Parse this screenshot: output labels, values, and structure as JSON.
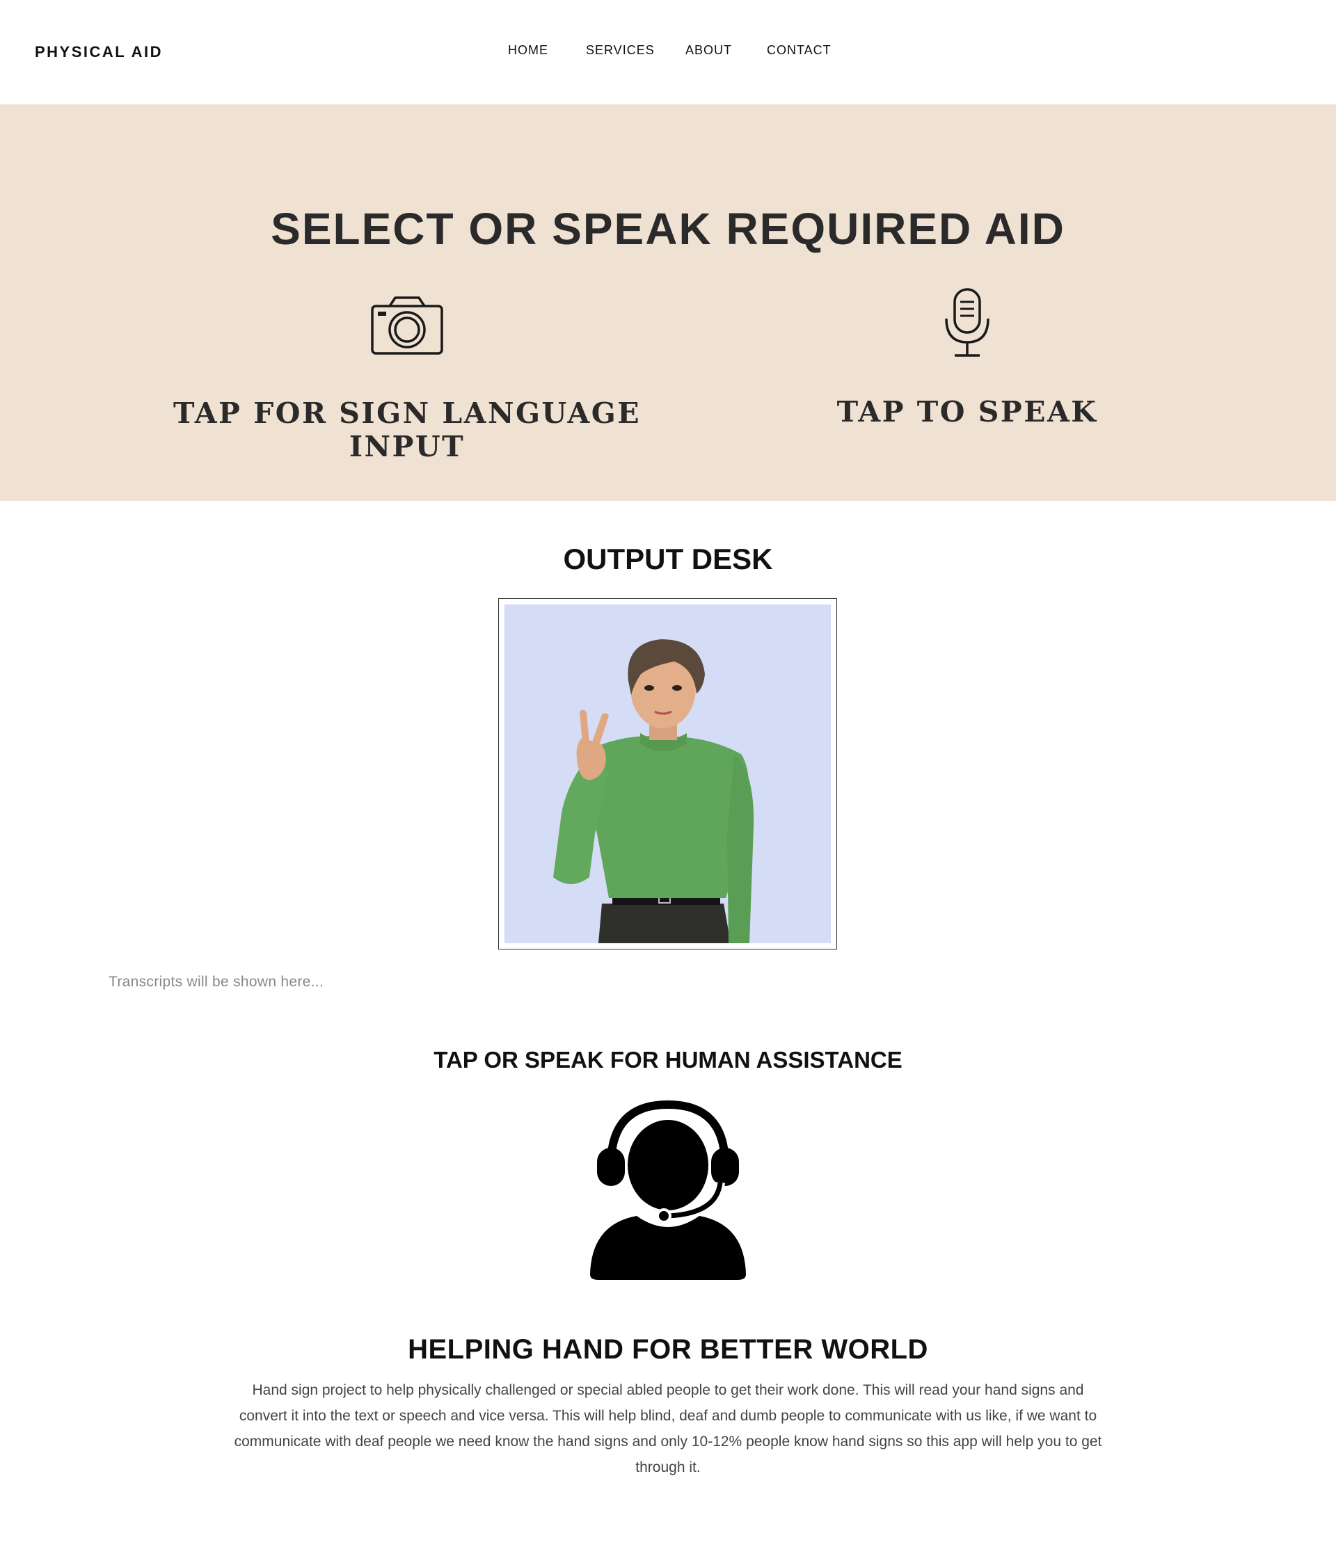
{
  "brand": {
    "name": "PHYSICAL AID"
  },
  "nav": {
    "home": "HOME",
    "services": "SERVICES",
    "about": "ABOUT",
    "contact": "CONTACT",
    "active": "HOME"
  },
  "hero": {
    "title": "SELECT OR SPEAK REQUIRED AID",
    "sign_option": {
      "label": "TAP FOR SIGN LANGUAGE INPUT",
      "icon": "camera-icon"
    },
    "speak_option": {
      "label": "TAP TO SPEAK",
      "icon": "microphone-icon"
    },
    "background_color": "#f0e2d3"
  },
  "output": {
    "title": "OUTPUT DESK",
    "avatar": "sign-language-avatar",
    "transcript_placeholder": "Transcripts will be shown here..."
  },
  "assistance": {
    "title": "TAP OR SPEAK FOR HUMAN ASSISTANCE",
    "icon": "customer-support-headset-icon"
  },
  "about": {
    "title": "HELPING HAND FOR BETTER WORLD",
    "text": "Hand sign project to help physically challenged or special abled people to get their work done. This will read your hand signs and convert it into the text or speech and vice versa. This will help blind, deaf and dumb people to communicate with us like, if we want to communicate with deaf people we need know the hand signs and only 10-12% people know hand signs so this app will help you to get through it."
  }
}
